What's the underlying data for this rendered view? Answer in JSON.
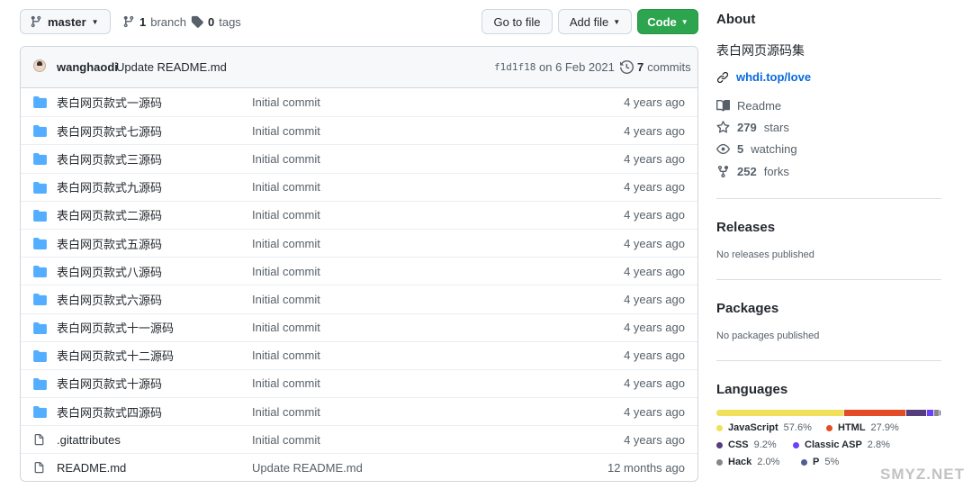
{
  "toolbar": {
    "branch": "master",
    "branch_count": "1",
    "branch_word": "branch",
    "tag_count": "0",
    "tag_word": "tags",
    "goto_file": "Go to file",
    "add_file": "Add file",
    "code": "Code"
  },
  "commit": {
    "author": "wanghaodi",
    "message": "Update README.md",
    "sha": "f1d1f18",
    "date": "on 6 Feb 2021",
    "count": "7",
    "count_word": "commits"
  },
  "files": [
    {
      "type": "dir",
      "name": "表白网页款式一源码",
      "message": "Initial commit",
      "age": "4 years ago"
    },
    {
      "type": "dir",
      "name": "表白网页款式七源码",
      "message": "Initial commit",
      "age": "4 years ago"
    },
    {
      "type": "dir",
      "name": "表白网页款式三源码",
      "message": "Initial commit",
      "age": "4 years ago"
    },
    {
      "type": "dir",
      "name": "表白网页款式九源码",
      "message": "Initial commit",
      "age": "4 years ago"
    },
    {
      "type": "dir",
      "name": "表白网页款式二源码",
      "message": "Initial commit",
      "age": "4 years ago"
    },
    {
      "type": "dir",
      "name": "表白网页款式五源码",
      "message": "Initial commit",
      "age": "4 years ago"
    },
    {
      "type": "dir",
      "name": "表白网页款式八源码",
      "message": "Initial commit",
      "age": "4 years ago"
    },
    {
      "type": "dir",
      "name": "表白网页款式六源码",
      "message": "Initial commit",
      "age": "4 years ago"
    },
    {
      "type": "dir",
      "name": "表白网页款式十一源码",
      "message": "Initial commit",
      "age": "4 years ago"
    },
    {
      "type": "dir",
      "name": "表白网页款式十二源码",
      "message": "Initial commit",
      "age": "4 years ago"
    },
    {
      "type": "dir",
      "name": "表白网页款式十源码",
      "message": "Initial commit",
      "age": "4 years ago"
    },
    {
      "type": "dir",
      "name": "表白网页款式四源码",
      "message": "Initial commit",
      "age": "4 years ago"
    },
    {
      "type": "file",
      "name": ".gitattributes",
      "message": "Initial commit",
      "age": "4 years ago"
    },
    {
      "type": "file",
      "name": "README.md",
      "message": "Update README.md",
      "age": "12 months ago"
    }
  ],
  "about": {
    "title": "About",
    "description": "表白网页源码集",
    "link": "whdi.top/love",
    "readme": "Readme",
    "stars_count": "279",
    "stars_word": "stars",
    "watching_count": "5",
    "watching_word": "watching",
    "forks_count": "252",
    "forks_word": "forks"
  },
  "releases": {
    "title": "Releases",
    "empty": "No releases published"
  },
  "packages": {
    "title": "Packages",
    "empty": "No packages published"
  },
  "languages": {
    "title": "Languages",
    "items": [
      {
        "name": "JavaScript",
        "percent": "57.6%",
        "value": 57.6,
        "color": "#f1e05a"
      },
      {
        "name": "HTML",
        "percent": "27.9%",
        "value": 27.9,
        "color": "#e34c26"
      },
      {
        "name": "CSS",
        "percent": "9.2%",
        "value": 9.2,
        "color": "#563d7c"
      },
      {
        "name": "Classic ASP",
        "percent": "2.8%",
        "value": 2.8,
        "color": "#6a40fd"
      },
      {
        "name": "Hack",
        "percent": "2.0%",
        "value": 2.0,
        "color": "#878787"
      },
      {
        "name": "P",
        "percent": "5%",
        "value": 0.5,
        "color": "#4f5d95"
      }
    ]
  },
  "watermark": "SMYZ.NET"
}
